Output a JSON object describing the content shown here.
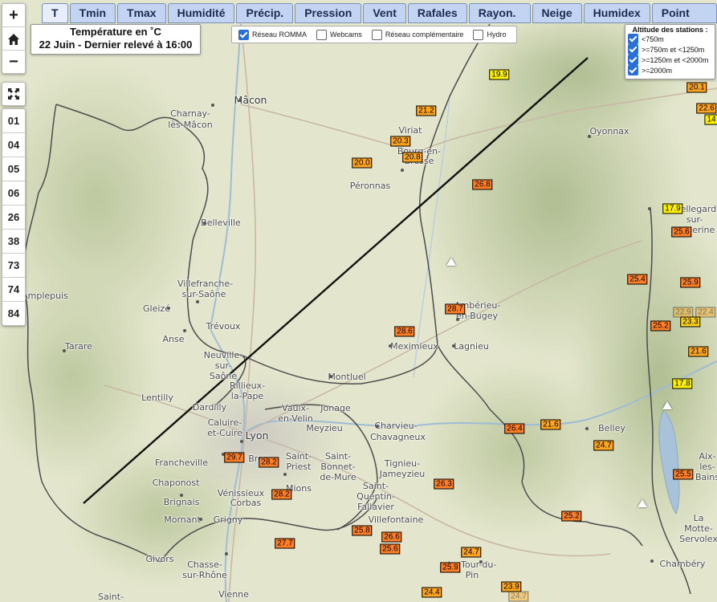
{
  "tabs": [
    "T",
    "Tmin",
    "Tmax",
    "Humidité",
    "Précip.",
    "Pression",
    "Vent",
    "Rafales",
    "Rayon. sol.",
    "Neige",
    "Humidex",
    "Point Rosée"
  ],
  "active_tab": "T",
  "zoom_controls": [
    "+",
    "⌂",
    "−"
  ],
  "fullscreen_icon": "fullscreen-icon",
  "hour_buttons": [
    "01",
    "04",
    "05",
    "06",
    "26",
    "38",
    "73",
    "74",
    "84"
  ],
  "info": {
    "line1": "Température en ˚C",
    "line2": "22 Juin - Dernier relevé à 16:00"
  },
  "networks": [
    {
      "label": "Réseau ROMMA",
      "checked": true
    },
    {
      "label": "Webcams",
      "checked": false
    },
    {
      "label": "Réseau complémentaire",
      "checked": false
    },
    {
      "label": "Hydro",
      "checked": false
    }
  ],
  "altitude": {
    "title": "Altitude des stations :",
    "items": [
      {
        "label": "<750m",
        "checked": true
      },
      {
        "label": ">=750m et <1250m",
        "checked": true
      },
      {
        "label": ">=1250m et <2000m",
        "checked": true
      },
      {
        "label": ">=2000m",
        "checked": true
      }
    ]
  },
  "colors": {
    "hot": "#ff7f27",
    "warm": "#ffa51f",
    "mild": "#ffd21a",
    "cool": "#fff200",
    "tab_bg": "#c2d4f2"
  },
  "places": [
    "Mâcon",
    "Charnay-lès-Mâcon",
    "Viriat",
    "Bourg-en-Bresse",
    "Péronnas",
    "Oyonnax",
    "Belleville",
    "Villefranche-sur-Saône",
    "Gleizé",
    "Amplepuis",
    "Anse",
    "Trévoux",
    "Tarare",
    "Neuville-sur-Saône",
    "Rillieux-la-Pape",
    "Montluel",
    "Meximieux",
    "Lagnieu",
    "Ambérieu-en-Bugey",
    "Lentilly",
    "Dardilly",
    "Caluire-et-Cuire",
    "Vaulx-en-Velin",
    "Jonage",
    "Meyzieu",
    "Lyon",
    "Charvieu-Chavagneux",
    "Francheville",
    "Bron",
    "Saint-Priest",
    "Saint-Bonnet-de-Mure",
    "Tignieu-Jameyzieu",
    "Chaponost",
    "Brignais",
    "Vénissieux",
    "Corbas",
    "Mions",
    "Saint-Quentin-Fallavier",
    "Villefontaine",
    "Mornant",
    "Grigny",
    "Givors",
    "Chasse-sur-Rhône",
    "Vienne",
    "Saint-",
    "La Tour-du-Pin",
    "Belley",
    "Aix-les-Bains",
    "La Motte-Servolex",
    "Chambéry",
    "Bellegarde-sur-Valserine"
  ],
  "stations": [
    "19.9",
    "21.2",
    "20.3",
    "20.8",
    "20.0",
    "26.8",
    "20.1",
    "22.6",
    "14",
    "17.9",
    "25.6",
    "25.4",
    "25.9",
    "28.7",
    "28.6",
    "25.2",
    "22.9",
    "22.4",
    "23.3",
    "21.6",
    "17.8",
    "21.6",
    "26.4",
    "24.7",
    "29.7",
    "28.2",
    "28.2",
    "26.3",
    "25.5",
    "25.2",
    "25.8",
    "26.6",
    "25.6",
    "27.7",
    "24.7",
    "25.9",
    "23.9",
    "24.7",
    "24.4"
  ]
}
